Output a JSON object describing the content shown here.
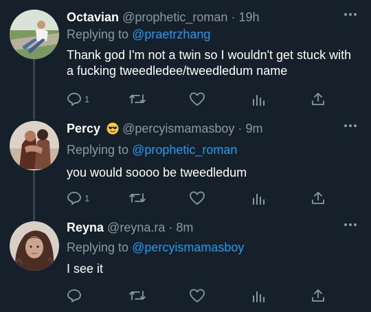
{
  "colors": {
    "background": "#15202b",
    "text": "#ffffff",
    "secondary": "#8b98a5",
    "accent": "#1d9bf0",
    "thread_line": "#38444d"
  },
  "tweets": [
    {
      "name": "Octavian",
      "handle": "@prophetic_roman",
      "separator": "·",
      "time": "19h",
      "replying_prefix": "Replying to",
      "replying_to": "@praetrzhang",
      "text": "Thank god I'm not a twin so I wouldn't get stuck with a fucking tweedledee/tweedledum name",
      "reply_count": "1"
    },
    {
      "name": "Percy",
      "emoji": "smiling-face-with-sunglasses-icon",
      "handle": "@percyismamasboy",
      "separator": "·",
      "time": "9m",
      "replying_prefix": "Replying to",
      "replying_to": "@prophetic_roman",
      "text": "you would soooo be tweedledum",
      "reply_count": "1"
    },
    {
      "name": "Reyna",
      "handle": "@reyna.ra",
      "separator": "·",
      "time": "8m",
      "replying_prefix": "Replying to",
      "replying_to": "@percyismamasboy",
      "text": "I see it",
      "reply_count": ""
    }
  ]
}
